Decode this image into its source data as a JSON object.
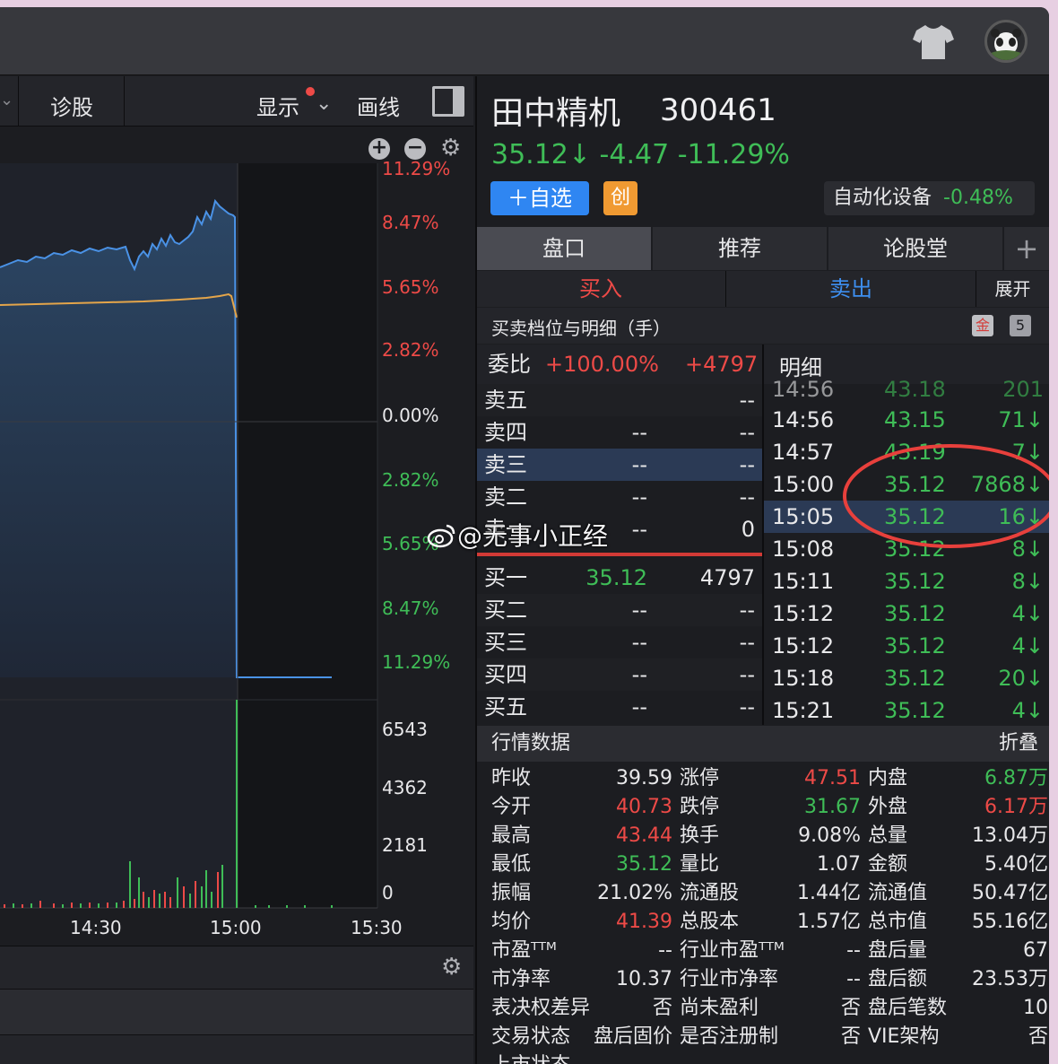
{
  "toolbar": {
    "diagnose": "诊股",
    "display": "显示",
    "draw": "画线"
  },
  "chart": {
    "y_pct_labels": [
      "11.29%",
      "8.47%",
      "5.65%",
      "2.82%",
      "0.00%",
      "2.82%",
      "5.65%",
      "8.47%",
      "11.29%"
    ],
    "vol_labels": [
      "6543",
      "4362",
      "2181",
      "0"
    ],
    "time_labels": [
      "14:30",
      "15:00",
      "15:30"
    ]
  },
  "stock": {
    "name": "田中精机",
    "code": "300461",
    "price_line": "35.12↓ -4.47 -11.29%",
    "add_watch": "＋自选",
    "board": "创",
    "sector": "自动化设备",
    "sector_change": "-0.48%"
  },
  "tabs": [
    "盘口",
    "推荐",
    "论股堂",
    "+"
  ],
  "trade": {
    "buy": "买入",
    "sell": "卖出",
    "expand": "展开"
  },
  "depth_header": {
    "title": "买卖档位与明细（手）",
    "badge1": "金",
    "badge2": "5"
  },
  "orderbook": {
    "ratio_label": "委比",
    "ratio_pct": "+100.00%",
    "ratio_diff": "+4797",
    "rows": [
      {
        "n": "卖五",
        "p": "",
        "v": "--"
      },
      {
        "n": "卖四",
        "p": "--",
        "v": "--"
      },
      {
        "n": "卖三",
        "p": "--",
        "v": "--"
      },
      {
        "n": "卖二",
        "p": "--",
        "v": "--"
      },
      {
        "n": "卖一",
        "p": "--",
        "v": "0"
      },
      {
        "n": "买一",
        "p": "35.12",
        "v": "4797"
      },
      {
        "n": "买二",
        "p": "--",
        "v": "--"
      },
      {
        "n": "买三",
        "p": "--",
        "v": "--"
      },
      {
        "n": "买四",
        "p": "--",
        "v": "--"
      },
      {
        "n": "买五",
        "p": "--",
        "v": "--"
      }
    ]
  },
  "detail": {
    "title": "明细",
    "rows": [
      {
        "t": "14:56",
        "p": "43.18",
        "v": "201"
      },
      {
        "t": "14:56",
        "p": "43.15",
        "v": "71↓"
      },
      {
        "t": "14:57",
        "p": "43.19",
        "v": "7↓"
      },
      {
        "t": "15:00",
        "p": "35.12",
        "v": "7868↓"
      },
      {
        "t": "15:05",
        "p": "35.12",
        "v": "16↓"
      },
      {
        "t": "15:08",
        "p": "35.12",
        "v": "8↓"
      },
      {
        "t": "15:11",
        "p": "35.12",
        "v": "8↓"
      },
      {
        "t": "15:12",
        "p": "35.12",
        "v": "4↓"
      },
      {
        "t": "15:12",
        "p": "35.12",
        "v": "4↓"
      },
      {
        "t": "15:18",
        "p": "35.12",
        "v": "20↓"
      },
      {
        "t": "15:21",
        "p": "35.12",
        "v": "4↓"
      }
    ]
  },
  "market": {
    "title": "行情数据",
    "collapse": "折叠",
    "rows": [
      [
        "昨收",
        "39.59",
        "涨停",
        "47.51",
        "内盘",
        "6.87万"
      ],
      [
        "今开",
        "40.73",
        "跌停",
        "31.67",
        "外盘",
        "6.17万"
      ],
      [
        "最高",
        "43.44",
        "换手",
        "9.08%",
        "总量",
        "13.04万"
      ],
      [
        "最低",
        "35.12",
        "量比",
        "1.07",
        "金额",
        "5.40亿"
      ],
      [
        "振幅",
        "21.02%",
        "流通股",
        "1.44亿",
        "流通值",
        "50.47亿"
      ],
      [
        "均价",
        "41.39",
        "总股本",
        "1.57亿",
        "总市值",
        "55.16亿"
      ],
      [
        "市盈ᵀᵀᴹ",
        "--",
        "行业市盈ᵀᵀᴹ",
        "--",
        "盘后量",
        "67"
      ],
      [
        "市净率",
        "10.37",
        "行业市净率",
        "--",
        "盘后额",
        "23.53万"
      ],
      [
        "表决权差异",
        "否",
        "尚未盈利",
        "否",
        "盘后笔数",
        "10"
      ],
      [
        "交易状态",
        "盘后固价",
        "是否注册制",
        "否",
        "VIE架构",
        "否"
      ],
      [
        "上市状态",
        "--",
        "",
        "",
        "",
        ""
      ]
    ]
  },
  "watermark": "@无事小正经",
  "colors": {
    "up": "#ed4a47",
    "down": "#3fbd57",
    "accent": "#2f86f2",
    "circle": "#e8403c"
  }
}
